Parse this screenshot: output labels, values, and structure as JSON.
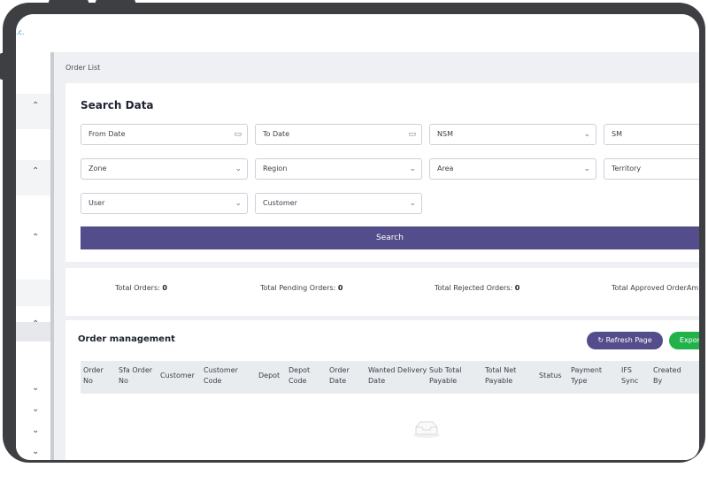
{
  "app": {
    "logo_text": ".c."
  },
  "breadcrumb": "Order List",
  "search": {
    "title": "Search Data",
    "fields": [
      {
        "label": "From Date",
        "icon": "calendar-icon"
      },
      {
        "label": "To Date",
        "icon": "calendar-icon"
      },
      {
        "label": "NSM",
        "icon": "chevron-down-icon"
      },
      {
        "label": "SM",
        "icon": "chevron-down-icon"
      },
      {
        "label": "Zone",
        "icon": "chevron-down-icon"
      },
      {
        "label": "Region",
        "icon": "chevron-down-icon"
      },
      {
        "label": "Area",
        "icon": "chevron-down-icon"
      },
      {
        "label": "Territory",
        "icon": "chevron-down-icon"
      },
      {
        "label": "User",
        "icon": "chevron-down-icon"
      },
      {
        "label": "Customer",
        "icon": "chevron-down-icon"
      }
    ],
    "button_label": "Search",
    "button_color": "#544d8b"
  },
  "stats": {
    "total_orders_label": "Total Orders:",
    "total_orders_value": "0",
    "pending_label": "Total Pending Orders:",
    "pending_value": "0",
    "rejected_label": "Total Rejected Orders:",
    "rejected_value": "0",
    "approved_label": "Total Approved OrderAm"
  },
  "orders": {
    "title": "Order management",
    "refresh_label": "Refresh Page",
    "refresh_color": "#544d8b",
    "export_label": "Export",
    "export_color": "#21b34a",
    "columns": [
      "Order No",
      "Sfa Order No",
      "Customer",
      "Customer Code",
      "Depot",
      "Depot Code",
      "Order Date",
      "Wanted Delivery Date",
      "Sub Total Payable",
      "Total Net Payable",
      "Status",
      "Payment Type",
      "IFS Sync",
      "Created By"
    ]
  }
}
